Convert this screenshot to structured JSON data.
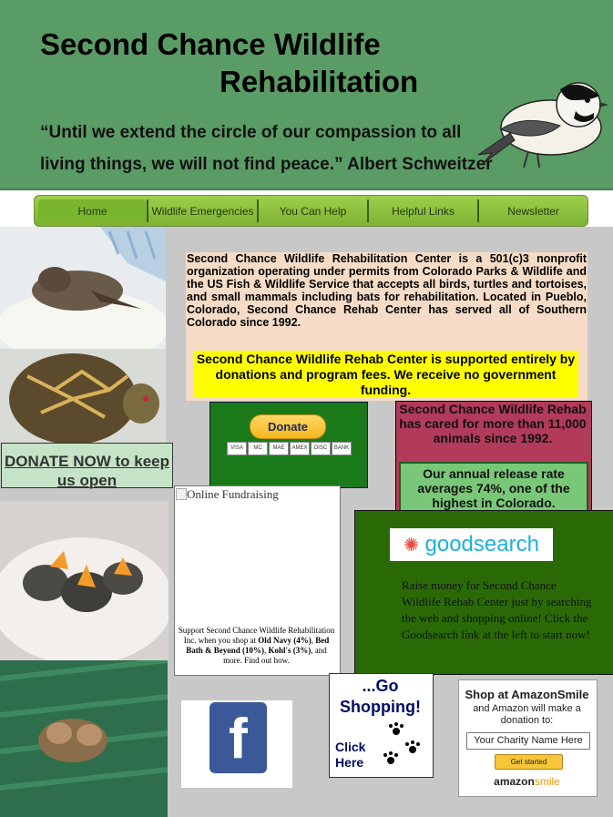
{
  "header": {
    "title_line1": "Second Chance Wildlife",
    "title_line2": "Rehabilitation",
    "quote_line1": "“Until we extend the circle of our compassion to all",
    "quote_line2": "living things, we will not find peace.”  Albert Schweitzer",
    "bg_color": "#5a9c65"
  },
  "nav": {
    "items": [
      {
        "label": "Home"
      },
      {
        "label": "Wildlife Emergencies"
      },
      {
        "label": "You Can Help"
      },
      {
        "label": "Helpful Links"
      },
      {
        "label": "Newsletter"
      }
    ]
  },
  "intro": {
    "text": "Second Chance Wildlife Rehabilitation Center is a 501(c)3 nonprofit organization operating under permits from Colorado Parks & Wildlife and the US Fish & Wildlife Service that accepts all birds, turtles and tortoises, and small mammals including bats for rehabilitation. Located in Pueblo, Colorado, Second Chance Rehab Center has served all of Southern Colorado since 1992.",
    "support": "Second Chance Wildlife Rehab Center is supported entirely by donations and program fees. We receive no government funding."
  },
  "donate": {
    "button_label": "Donate",
    "cards": [
      "VISA",
      "MC",
      "MAE",
      "AMEX",
      "DISC",
      "BANK"
    ]
  },
  "donate_now": {
    "label": "DONATE NOW to keep us open"
  },
  "stats": {
    "cared": "Second Chance Wildlife Rehab has cared for more than 11,000 animals since 1992.",
    "release": "Our annual release rate averages 74%, one of the highest in Colorado."
  },
  "fundraising": {
    "img_alt": "Online Fundraising",
    "text_prefix": "Support Second Chance Wildlife Rehabilitation Inc. when you shop at ",
    "store1": "Old Navy (4%)",
    "sep1": ", ",
    "store2": "Bed Bath & Beyond (10%)",
    "sep2": ", ",
    "store3": "Kohl's (3%)",
    "text_suffix": ", and more. Find out how."
  },
  "goodsearch": {
    "logo": "goodsearch",
    "text": "Raise money for Second Chance Wildlife Rehab Center just by searching the web and shopping online! Click the Goodsearch link at the left to start now!"
  },
  "facebook": {
    "icon": "f"
  },
  "shopping": {
    "title": "...Go Shopping!",
    "click": "Click Here"
  },
  "amazon": {
    "title": "Shop at AmazonSmile",
    "subtitle": "and Amazon will make a donation to:",
    "charity": "Your Charity Name Here",
    "button": "Get started",
    "logo_main": "amazon",
    "logo_smile": "smile"
  }
}
